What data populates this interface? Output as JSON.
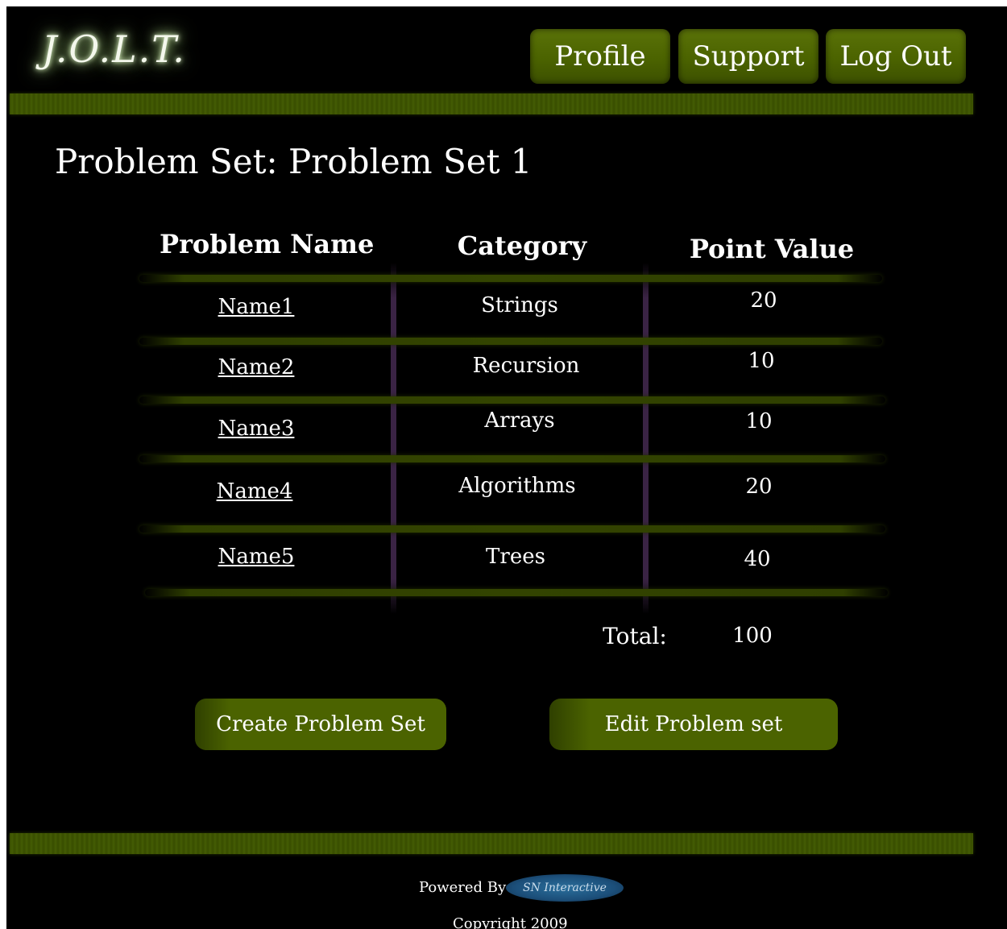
{
  "header": {
    "logo": "J.O.L.T.",
    "nav": [
      {
        "label": "Profile"
      },
      {
        "label": "Support"
      },
      {
        "label": "Log Out"
      }
    ]
  },
  "page": {
    "title": "Problem Set: Problem Set 1"
  },
  "table": {
    "columns": [
      "Problem Name",
      "Category",
      "Point Value"
    ],
    "rows": [
      {
        "name": "Name1",
        "category": "Strings",
        "points": "20"
      },
      {
        "name": "Name2",
        "category": "Recursion",
        "points": "10"
      },
      {
        "name": "Name3",
        "category": "Arrays",
        "points": "10"
      },
      {
        "name": "Name4",
        "category": "Algorithms",
        "points": "20"
      },
      {
        "name": "Name5",
        "category": "Trees",
        "points": "40"
      }
    ],
    "total_label": "Total:",
    "total_value": "100"
  },
  "actions": {
    "create": "Create Problem Set",
    "edit": "Edit Problem set"
  },
  "footer": {
    "powered_by": "Powered By",
    "sponsor_logo_text": "SN Interactive",
    "copyright": "Copyright 2009"
  }
}
